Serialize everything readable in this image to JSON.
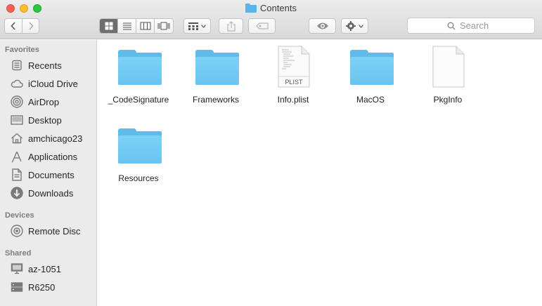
{
  "window": {
    "title": "Contents"
  },
  "toolbar": {
    "back_icon": "chevron-left-icon",
    "forward_icon": "chevron-right-icon",
    "view_modes": [
      "icon-view-icon",
      "list-view-icon",
      "column-view-icon",
      "cover-flow-icon"
    ],
    "active_view": "icon-view-icon",
    "arrange_icon": "arrange-icon",
    "share_icon": "share-icon",
    "tag_icon": "tag-icon",
    "quicklook_icon": "eye-icon",
    "action_icon": "gear-icon",
    "search_placeholder": "Search"
  },
  "sidebar": {
    "favorites_title": "Favorites",
    "favorites": [
      {
        "label": "Recents",
        "icon": "recents-icon"
      },
      {
        "label": "iCloud Drive",
        "icon": "cloud-icon"
      },
      {
        "label": "AirDrop",
        "icon": "airdrop-icon"
      },
      {
        "label": "Desktop",
        "icon": "desktop-icon"
      },
      {
        "label": "amchicago23",
        "icon": "home-icon"
      },
      {
        "label": "Applications",
        "icon": "applications-icon"
      },
      {
        "label": "Documents",
        "icon": "documents-icon"
      },
      {
        "label": "Downloads",
        "icon": "downloads-icon"
      }
    ],
    "devices_title": "Devices",
    "devices": [
      {
        "label": "Remote Disc",
        "icon": "disc-icon"
      }
    ],
    "shared_title": "Shared",
    "shared": [
      {
        "label": "az-1051",
        "icon": "computer-icon"
      },
      {
        "label": "R6250",
        "icon": "server-icon"
      }
    ]
  },
  "files": [
    {
      "name": "_CodeSignature",
      "kind": "folder"
    },
    {
      "name": "Frameworks",
      "kind": "folder"
    },
    {
      "name": "Info.plist",
      "kind": "plist",
      "badge": "PLIST"
    },
    {
      "name": "MacOS",
      "kind": "folder"
    },
    {
      "name": "PkgInfo",
      "kind": "document"
    },
    {
      "name": "Resources",
      "kind": "folder"
    }
  ],
  "colors": {
    "folder": "#69c4ef",
    "sidebar": "#ebebeb",
    "accent": "#6e6e6e"
  }
}
